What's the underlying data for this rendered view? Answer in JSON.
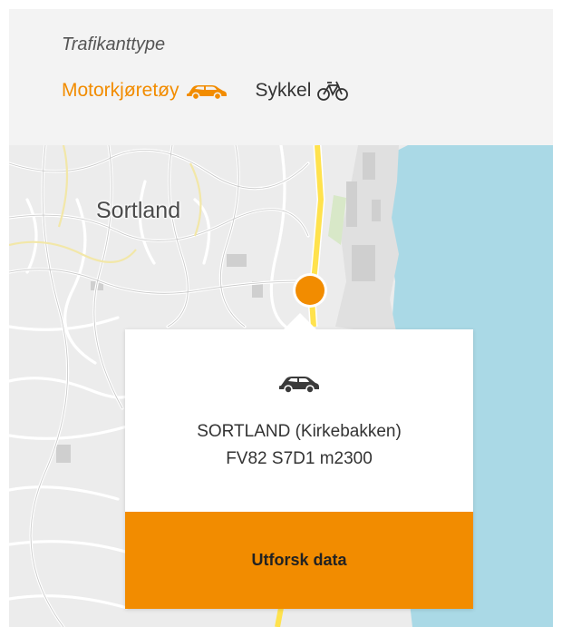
{
  "filter": {
    "label": "Trafikanttype",
    "options": [
      {
        "label": "Motorkjøretøy",
        "icon": "car-icon",
        "active": true
      },
      {
        "label": "Sykkel",
        "icon": "bicycle-icon",
        "active": false
      }
    ]
  },
  "map": {
    "place_label": "Sortland"
  },
  "popup": {
    "vehicle_icon": "car-icon",
    "station_name": "SORTLAND (Kirkebakken)",
    "station_ref": "FV82 S7D1 m2300",
    "action_label": "Utforsk data"
  },
  "colors": {
    "accent": "#f28c00",
    "water": "#aad9e6",
    "land": "#eeeeee",
    "main_road": "#ffe24d",
    "header_bg": "#f3f3f3"
  }
}
